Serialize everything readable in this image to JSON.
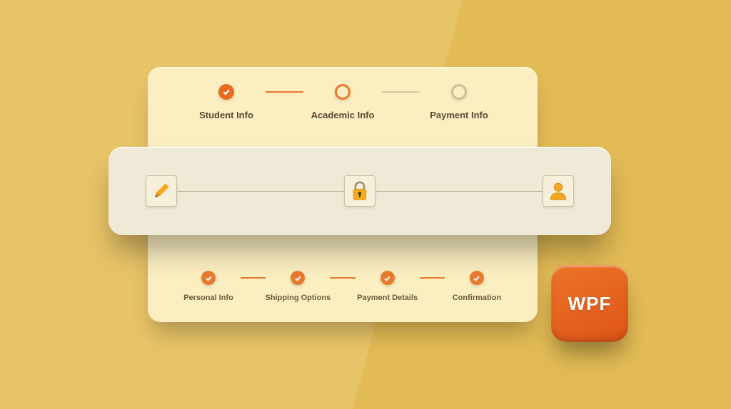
{
  "top_stepper": {
    "steps": [
      "Student Info",
      "Academic Info",
      "Payment Info"
    ],
    "state": [
      "done",
      "ring",
      "empty"
    ],
    "connectors": [
      "active",
      "inactive"
    ]
  },
  "icon_stepper": {
    "icons": [
      "pencil-icon",
      "lock-icon",
      "user-icon"
    ]
  },
  "bottom_stepper": {
    "steps": [
      "Personal Info",
      "Shipping Options",
      "Payment Details",
      "Confirmation"
    ]
  },
  "badge": {
    "label": "WPF"
  },
  "colors": {
    "accent": "#e97a2e",
    "accent_dark": "#e86a1f",
    "back_card": "#fbeec0",
    "front_card": "#efe9d7",
    "badge": "#e55a1a",
    "bg1": "#e8c468",
    "bg2": "#e2bb55"
  }
}
